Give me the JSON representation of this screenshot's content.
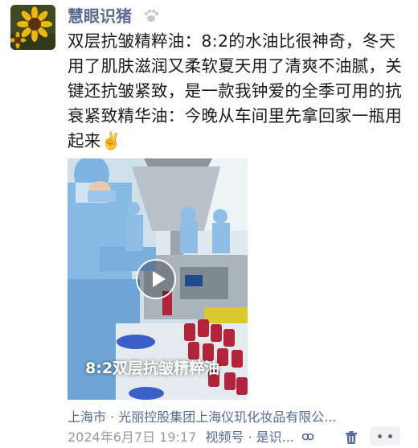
{
  "user": {
    "name": "慧眼识猪",
    "avatar_icon": "sunflower-avatar",
    "badge_icon": "paw-icon"
  },
  "post": {
    "text": "双层抗皱精粹油：8:2的水油比很神奇，冬天用了肌肤滋润又柔软夏天用了清爽不油腻，关键还抗皱紧致，是一款我钟爱的全季可用的抗衰紧致精华油：今晚从车间里先拿回家一瓶用起来✌️"
  },
  "video": {
    "caption": "8:2双层抗皱精粹油",
    "play_icon": "play-icon"
  },
  "location": "上海市 · 光丽控股集团上海仪玑化妆品有限公...",
  "meta": {
    "timestamp": "2024年6月7日 19:17",
    "channel": "视频号 · 是识...",
    "channel_icon": "channel-icon",
    "delete_icon": "trash-icon",
    "more_icon": "more-icon"
  },
  "colors": {
    "link": "#576b95",
    "meta_gray": "#9a9a9a",
    "text": "#1a1a1a"
  }
}
